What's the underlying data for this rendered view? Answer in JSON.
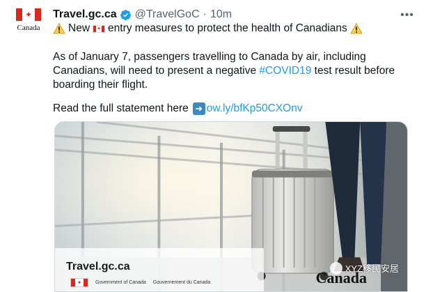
{
  "tweet": {
    "name": "Travel.gc.ca",
    "handle": "@TravelGoC",
    "separator": "·",
    "time": "10m",
    "more_label": "•••",
    "line1_a": "New",
    "line1_b": "entry measures to protect the health of Canadians",
    "para_a": "As of January 7, passengers travelling to Canada by air, including Canadians, will need to present a negative ",
    "hashtag": "#COVID19",
    "para_b": " test result before boarding their flight.",
    "read_text": "Read the full statement here",
    "short_link": "ow.ly/bfKp50CXOnv"
  },
  "avatar": {
    "wordmark": "Canada"
  },
  "media": {
    "caption": "Travel.gc.ca",
    "gov_en": "Government of Canada",
    "gov_fr": "Gouvernement du Canada",
    "wordmark": "Canada",
    "watermark": "XYZ移民安居"
  },
  "icons": {
    "verified": "verified-badge-icon",
    "warning": "warning-icon",
    "flag": "canada-flag-icon",
    "arrow": "right-arrow-icon",
    "more": "more-icon"
  },
  "colors": {
    "link": "#1d9bf0",
    "verified": "#1d9bf0",
    "flag_red": "#d52b1e",
    "muted": "#536471"
  }
}
